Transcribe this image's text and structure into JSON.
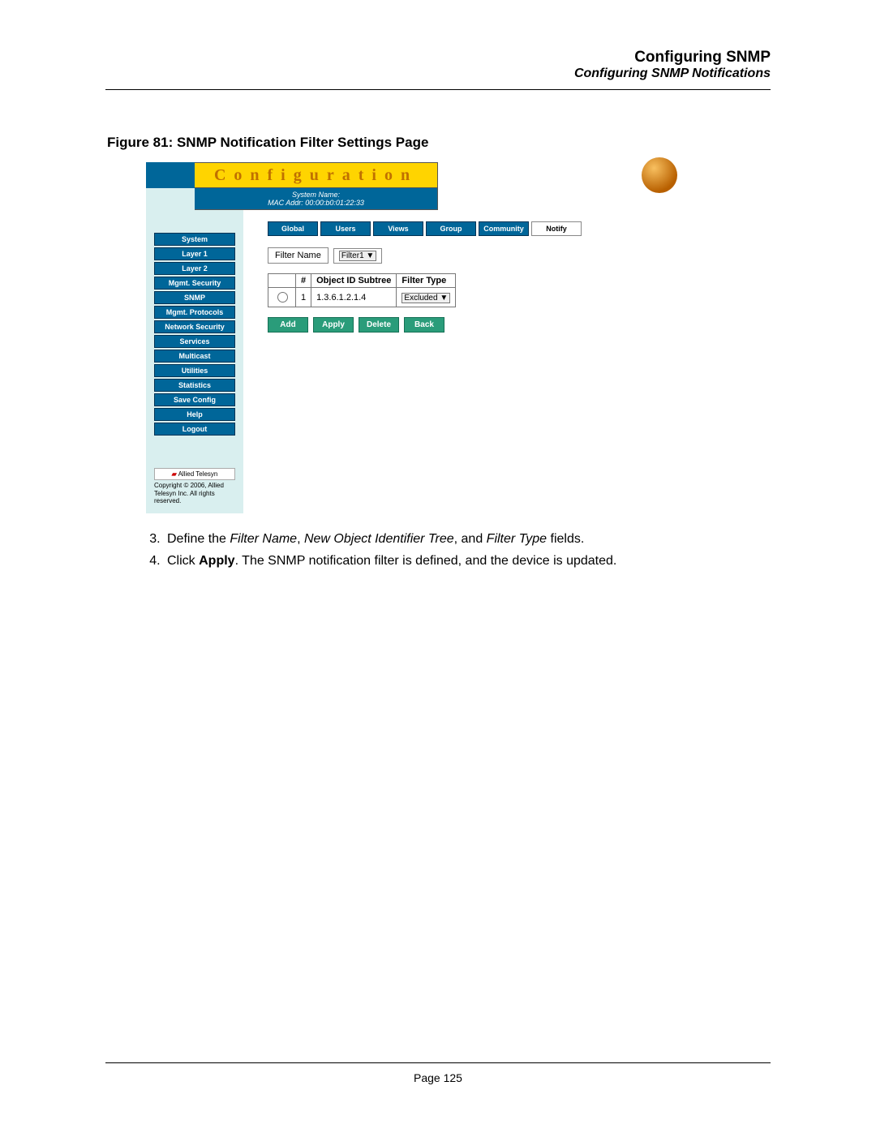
{
  "header": {
    "title": "Configuring SNMP",
    "subtitle": "Configuring SNMP Notifications"
  },
  "figure": {
    "caption": "Figure 81:  SNMP Notification Filter Settings Page"
  },
  "screenshot": {
    "banner_title": "Configuration",
    "system_name_label": "System Name:",
    "mac_label": "MAC Addr:  00:00:b0:01:22:33",
    "tabs": [
      "Global",
      "Users",
      "Views",
      "Group",
      "Community",
      "Notify"
    ],
    "sidebar_items": [
      "System",
      "Layer 1",
      "Layer 2",
      "Mgmt. Security",
      "SNMP",
      "Mgmt. Protocols",
      "Network Security",
      "Services",
      "Multicast",
      "Utilities",
      "Statistics",
      "Save Config",
      "Help",
      "Logout"
    ],
    "sidebar_logo_text": "Allied Telesyn",
    "sidebar_copyright": "Copyright © 2006, Allied Telesyn Inc. All rights reserved.",
    "filter_name_label": "Filter Name",
    "filter_name_value": "Filter1",
    "table": {
      "headers": [
        "#",
        "Object ID Subtree",
        "Filter Type"
      ],
      "row": {
        "num": "1",
        "oid": "1.3.6.1.2.1.4",
        "filter_type": "Excluded"
      }
    },
    "buttons": [
      "Add",
      "Apply",
      "Delete",
      "Back"
    ]
  },
  "steps": {
    "s3_pre": "Define the ",
    "s3_i1": "Filter Name",
    "s3_mid1": ", ",
    "s3_i2": "New Object Identifier Tree",
    "s3_mid2": ", and ",
    "s3_i3": "Filter Type",
    "s3_post": " fields.",
    "s4_pre": "Click ",
    "s4_b": "Apply",
    "s4_post": ". The SNMP notification filter is defined, and the device is updated."
  },
  "footer": {
    "page": "Page 125"
  }
}
